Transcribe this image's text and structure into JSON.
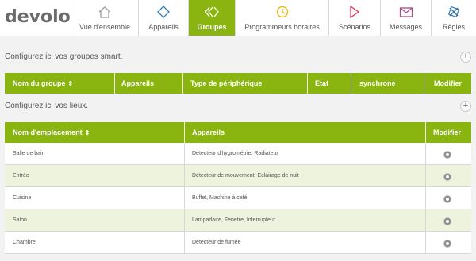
{
  "brand": "devolo",
  "nav": [
    {
      "label": "Vue d'ensemble",
      "icon": "home-icon",
      "color": "#9a9a9a"
    },
    {
      "label": "Appareils",
      "icon": "device-diamond-icon",
      "color": "#2b7fc1"
    },
    {
      "label": "Groupes",
      "icon": "group-chevrons-icon",
      "color": "#ffffff",
      "active": true
    },
    {
      "label": "Programmeurs horaires",
      "icon": "clock-icon",
      "color": "#f0b400"
    },
    {
      "label": "Scénarios",
      "icon": "play-icon",
      "color": "#e0365a"
    },
    {
      "label": "Messages",
      "icon": "envelope-icon",
      "color": "#b24a8f"
    },
    {
      "label": "Règles",
      "icon": "rules-icon",
      "color": "#2b6fb1"
    }
  ],
  "groups": {
    "title": "Configurez ici vos groupes smart.",
    "add": "+",
    "columns": [
      "Nom du groupe",
      "Appareils",
      "Type de périphérique",
      "Etat",
      "synchrone",
      "Modifier"
    ],
    "sort_symbol": "⇕"
  },
  "locations": {
    "title": "Configurez ici vos lieux.",
    "add": "+",
    "columns": [
      "Nom d'emplacement",
      "Appareils",
      "Modifier"
    ],
    "sort_symbol": "⇕",
    "rows": [
      {
        "name": "Salle de bain",
        "devices": "Détecteur d'hygrométrie, Radiateur"
      },
      {
        "name": "Entrée",
        "devices": "Détecteur de mouvement, Eclairage de nuit"
      },
      {
        "name": "Cuisine",
        "devices": "Buffet, Machine à café"
      },
      {
        "name": "Salon",
        "devices": "Lampadaire, Fenetre, Interrupteur"
      },
      {
        "name": "Chambre",
        "devices": "Détecteur de fumée"
      }
    ]
  },
  "colors": {
    "accent": "#8ab40f",
    "row_alt": "#eef3dd"
  }
}
